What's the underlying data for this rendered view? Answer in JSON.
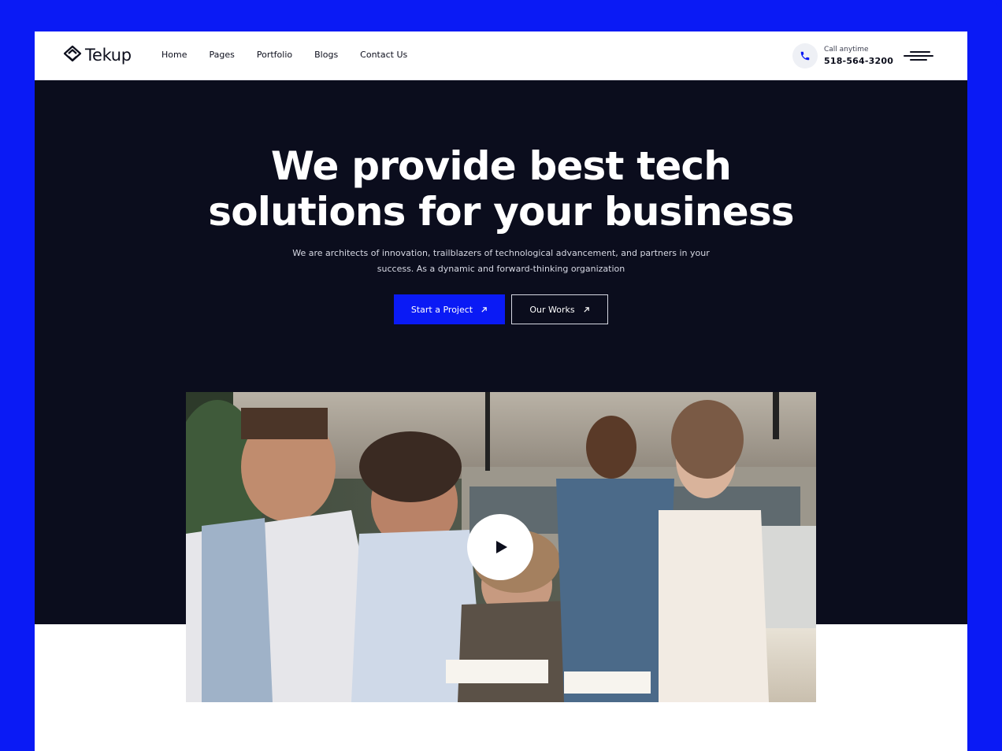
{
  "header": {
    "logo_text": "Tekup",
    "nav": [
      {
        "label": "Home"
      },
      {
        "label": "Pages"
      },
      {
        "label": "Portfolio"
      },
      {
        "label": "Blogs"
      },
      {
        "label": "Contact Us"
      }
    ],
    "call_label": "Call anytime",
    "call_number": "518-564-3200",
    "phone_icon": "phone-icon",
    "menu_icon": "hamburger-menu-icon"
  },
  "hero": {
    "title_line1": "We provide best tech",
    "title_line2": "solutions for your business",
    "subtitle": "We are architects of innovation, trailblazers of technological advancement, and partners in your success. As a dynamic and forward-thinking organization",
    "primary_button": "Start a Project",
    "secondary_button": "Our Works",
    "button_icon": "arrow-up-right-icon"
  },
  "video": {
    "play_icon": "play-icon"
  },
  "colors": {
    "accent": "#0a1af5",
    "hero_bg": "#0b0d1d",
    "text_dark": "#0c0e1c"
  }
}
